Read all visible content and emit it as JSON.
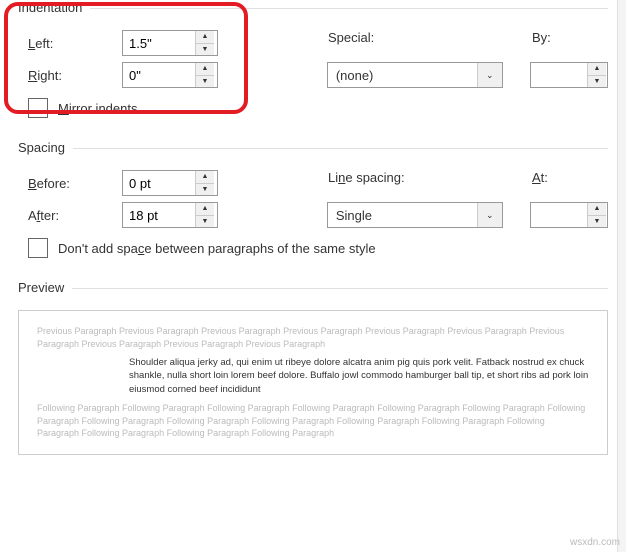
{
  "indentation": {
    "title": "Indentation",
    "left_label": "Left:",
    "left_value": "1.5\"",
    "right_label": "Right:",
    "right_value": "0\"",
    "special_label": "Special:",
    "special_value": "(none)",
    "by_label": "By:",
    "by_value": "",
    "mirror_label": "Mirror indents"
  },
  "spacing": {
    "title": "Spacing",
    "before_label": "Before:",
    "before_value": "0 pt",
    "after_label": "After:",
    "after_value": "18 pt",
    "line_spacing_label": "Line spacing:",
    "line_spacing_value": "Single",
    "at_label": "At:",
    "at_value": "",
    "dont_add_label": "Don't add space between paragraphs of the same style"
  },
  "preview": {
    "title": "Preview",
    "previous": "Previous Paragraph Previous Paragraph Previous Paragraph Previous Paragraph Previous Paragraph Previous Paragraph Previous Paragraph Previous Paragraph Previous Paragraph Previous Paragraph",
    "sample": "Shoulder aliqua jerky ad, qui enim ut ribeye dolore alcatra anim pig quis pork velit. Fatback nostrud ex chuck shankle, nulla short loin lorem beef dolore. Buffalo jowl commodo hamburger ball tip, et short ribs ad pork loin eiusmod corned beef incididunt",
    "following": "Following Paragraph Following Paragraph Following Paragraph Following Paragraph Following Paragraph Following Paragraph Following Paragraph Following Paragraph Following Paragraph Following Paragraph Following Paragraph Following Paragraph Following Paragraph Following Paragraph Following Paragraph Following Paragraph"
  },
  "watermark": "wsxdn.com"
}
